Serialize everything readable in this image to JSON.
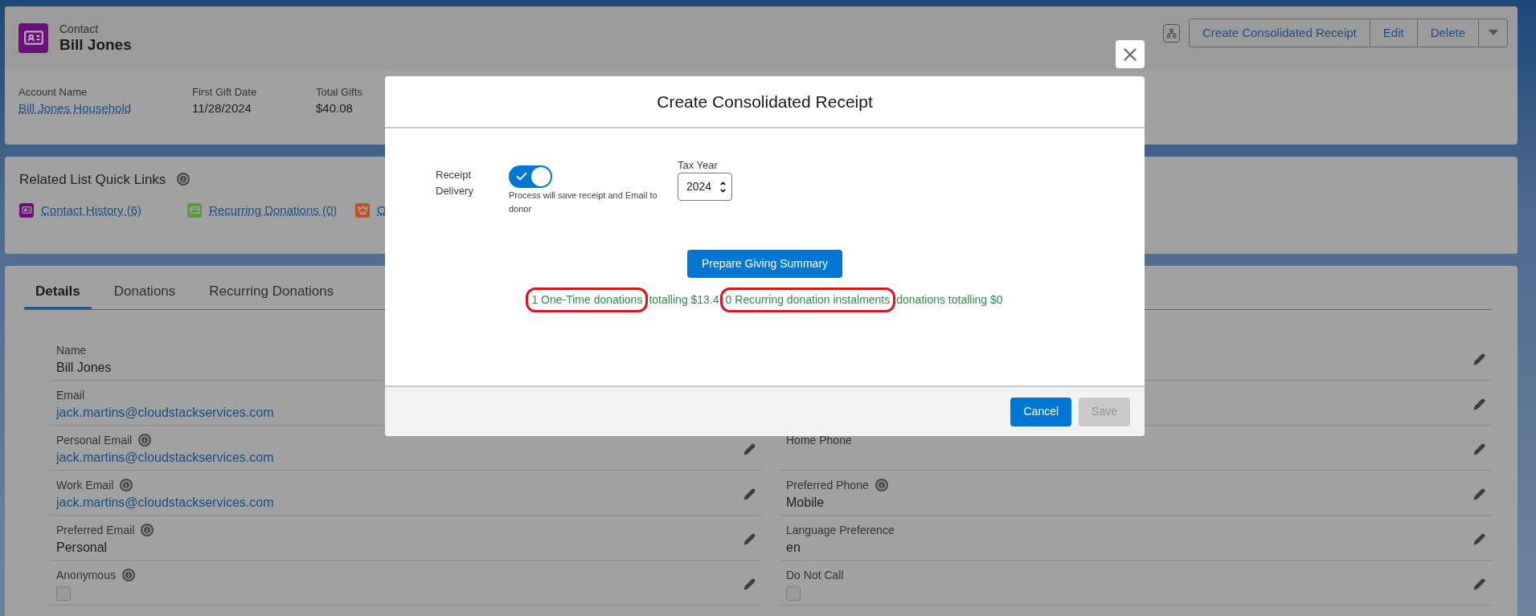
{
  "record": {
    "object_type": "Contact",
    "name": "Bill Jones"
  },
  "actions": [
    {
      "label": "Create Consolidated Receipt"
    },
    {
      "label": "Edit"
    },
    {
      "label": "Delete"
    }
  ],
  "highlights": [
    {
      "label": "Account Name",
      "value": "Bill Jones Household",
      "kind": "link"
    },
    {
      "label": "First Gift Date",
      "value": "11/28/2024",
      "kind": "text"
    },
    {
      "label": "Total Gifts",
      "value": "$40.08",
      "kind": "text"
    }
  ],
  "related_list": {
    "title": "Related List Quick Links",
    "links": [
      {
        "label": "Contact History (6)",
        "kind": "contact",
        "color": "#6b1079"
      },
      {
        "label": "Recurring Donations (0)",
        "kind": "card",
        "color": "#5e9744"
      },
      {
        "label": "O",
        "kind": "crown",
        "color": "#c2531f"
      }
    ]
  },
  "tabs": [
    {
      "label": "Details",
      "selected": true
    },
    {
      "label": "Donations",
      "selected": false
    },
    {
      "label": "Recurring Donations",
      "selected": false
    }
  ],
  "fields_left": [
    {
      "label": "Name",
      "value": "Bill Jones",
      "kind": "text",
      "info": false,
      "editable": false
    },
    {
      "label": "Email",
      "value": "jack.martins@cloudstackservices.com",
      "kind": "link",
      "info": false,
      "editable": false
    },
    {
      "label": "Personal Email",
      "value": "jack.martins@cloudstackservices.com",
      "kind": "link",
      "info": true,
      "editable": true
    },
    {
      "label": "Work Email",
      "value": "jack.martins@cloudstackservices.com",
      "kind": "link",
      "info": true,
      "editable": true
    },
    {
      "label": "Preferred Email",
      "value": "Personal",
      "kind": "text",
      "info": true,
      "editable": true
    },
    {
      "label": "Anonymous",
      "kind": "checkbox",
      "checked": false,
      "info": true,
      "editable": true
    }
  ],
  "fields_right": [
    {
      "kind": "text",
      "info": false,
      "editable": true
    },
    {
      "kind": "text",
      "info": false,
      "editable": true
    },
    {
      "label": "Home Phone",
      "kind": "text",
      "info": false,
      "editable": true
    },
    {
      "label": "Preferred Phone",
      "value": "Mobile",
      "kind": "text",
      "info": true,
      "editable": true
    },
    {
      "label": "Language Preference",
      "value": "en",
      "kind": "text",
      "info": false,
      "editable": true
    },
    {
      "label": "Do Not Call",
      "kind": "checkbox",
      "checked": false,
      "info": false,
      "editable": true
    }
  ],
  "modal": {
    "title": "Create Consolidated Receipt",
    "toggle": {
      "label": "Receipt Delivery",
      "on": true,
      "help": "Process will save receipt and Email to donor"
    },
    "tax_year": {
      "label": "Tax Year",
      "value": "2024"
    },
    "prepare_button": "Prepare Giving Summary",
    "summary": [
      {
        "text": "1 One-Time donations",
        "circled": true
      },
      {
        "text": "totalling $13.4",
        "circled": false
      },
      {
        "text": "0 Recurring donation instalments",
        "circled": true
      },
      {
        "text": "donations totalling $0",
        "circled": false
      }
    ],
    "buttons": [
      {
        "label": "Cancel",
        "disabled": false
      },
      {
        "label": "Save",
        "disabled": true
      }
    ]
  }
}
